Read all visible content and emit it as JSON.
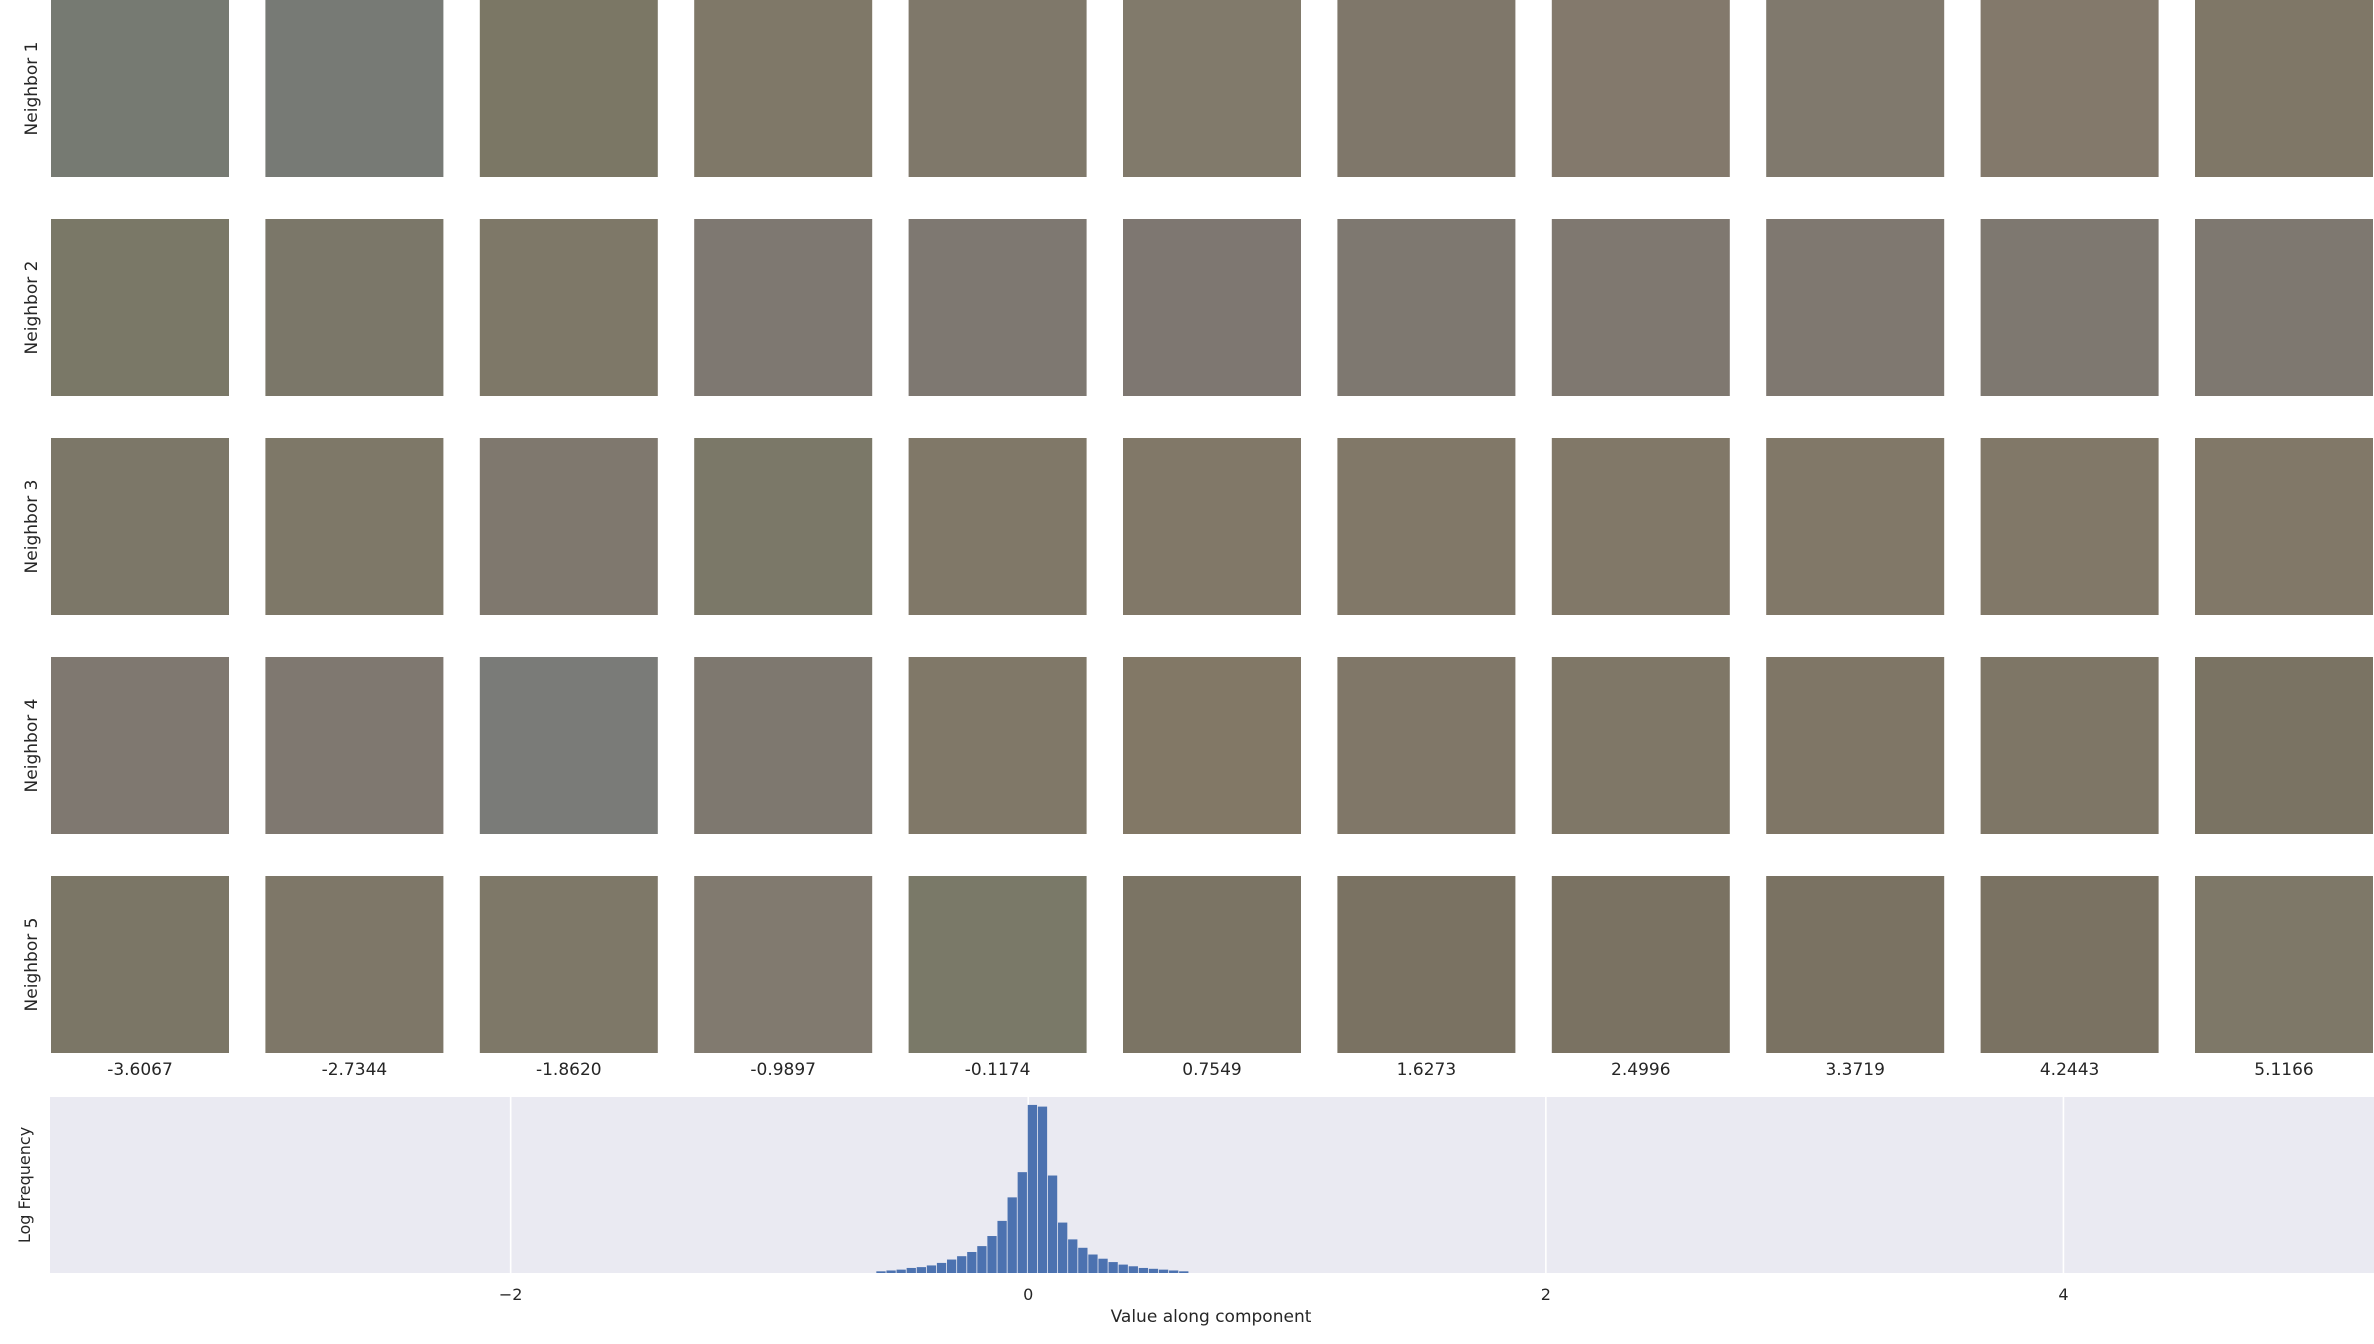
{
  "row_labels": [
    "Neighbor 1",
    "Neighbor 2",
    "Neighbor 3",
    "Neighbor 4",
    "Neighbor 5"
  ],
  "column_values": [
    "-3.6067",
    "-2.7344",
    "-1.8620",
    "-0.9897",
    "-0.1174",
    "0.7549",
    "1.6273",
    "2.4996",
    "3.3719",
    "4.2443",
    "5.1166"
  ],
  "tile_colors": [
    [
      "#767a72",
      "#777a75",
      "#7b7765",
      "#7f7868",
      "#7f786a",
      "#817a6b",
      "#7f776a",
      "#83796c",
      "#80796d",
      "#83796b",
      "#7f7767"
    ],
    [
      "#7a7867",
      "#7b7769",
      "#7e7868",
      "#7e7871",
      "#7e7871",
      "#7e7771",
      "#7e7870",
      "#7f7870",
      "#7f7870",
      "#7e7870",
      "#7e7870"
    ],
    [
      "#7c7768",
      "#7e7868",
      "#7f786e",
      "#7b7868",
      "#807868",
      "#817868",
      "#817868",
      "#817868",
      "#817868",
      "#817868",
      "#817868"
    ],
    [
      "#7f7870",
      "#7f7870",
      "#7a7b78",
      "#7e786f",
      "#807868",
      "#827866",
      "#807768",
      "#7f7767",
      "#7f7666",
      "#7e7666",
      "#7a7363"
    ],
    [
      "#7b7666",
      "#7e7768",
      "#7e7868",
      "#817a6f",
      "#7a7968",
      "#7b7464",
      "#7a7262",
      "#7a7262",
      "#7a7262",
      "#7a7262",
      "#7e7868"
    ]
  ],
  "chart_data": {
    "type": "bar",
    "title": "",
    "xlabel": "Value along component",
    "ylabel": "Log Frequency",
    "xlim": [
      -3.78,
      5.2
    ],
    "xticks": [
      -2,
      0,
      2,
      4
    ],
    "xtick_labels": [
      "−2",
      "0",
      "2",
      "4"
    ],
    "grid": true,
    "bin_width": 0.039,
    "bins": [
      {
        "x": -0.587,
        "height": 0.01
      },
      {
        "x": -0.548,
        "height": 0.015
      },
      {
        "x": -0.509,
        "height": 0.02
      },
      {
        "x": -0.47,
        "height": 0.03
      },
      {
        "x": -0.431,
        "height": 0.035
      },
      {
        "x": -0.392,
        "height": 0.045
      },
      {
        "x": -0.353,
        "height": 0.06
      },
      {
        "x": -0.314,
        "height": 0.08
      },
      {
        "x": -0.275,
        "height": 0.1
      },
      {
        "x": -0.236,
        "height": 0.125
      },
      {
        "x": -0.197,
        "height": 0.16
      },
      {
        "x": -0.158,
        "height": 0.22
      },
      {
        "x": -0.119,
        "height": 0.31
      },
      {
        "x": -0.08,
        "height": 0.45
      },
      {
        "x": -0.041,
        "height": 0.6
      },
      {
        "x": -0.002,
        "height": 1.0
      },
      {
        "x": 0.037,
        "height": 0.99
      },
      {
        "x": 0.076,
        "height": 0.58
      },
      {
        "x": 0.115,
        "height": 0.3
      },
      {
        "x": 0.154,
        "height": 0.2
      },
      {
        "x": 0.193,
        "height": 0.15
      },
      {
        "x": 0.232,
        "height": 0.11
      },
      {
        "x": 0.271,
        "height": 0.085
      },
      {
        "x": 0.31,
        "height": 0.065
      },
      {
        "x": 0.349,
        "height": 0.05
      },
      {
        "x": 0.388,
        "height": 0.04
      },
      {
        "x": 0.427,
        "height": 0.03
      },
      {
        "x": 0.466,
        "height": 0.025
      },
      {
        "x": 0.505,
        "height": 0.02
      },
      {
        "x": 0.544,
        "height": 0.015
      },
      {
        "x": 0.583,
        "height": 0.01
      }
    ],
    "bar_color": "#4c72b0",
    "background_color": "#eaeaf2"
  }
}
